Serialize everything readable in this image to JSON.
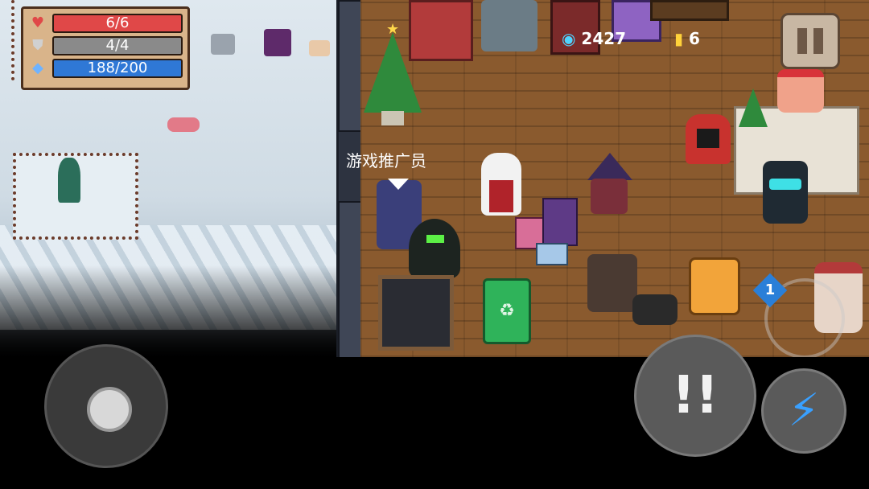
{
  "hud": {
    "hp": {
      "label": "6/6",
      "value": 6,
      "max": 6,
      "color": "#e04848"
    },
    "armor": {
      "label": "4/4",
      "value": 4,
      "max": 4,
      "color": "#8a8a8a"
    },
    "energy": {
      "label": "188/200",
      "value": 188,
      "max": 200,
      "color": "#2f78d6"
    },
    "icons": [
      "heart-icon",
      "shield-icon",
      "energy-crystal-icon"
    ]
  },
  "currency": {
    "gems": "2427",
    "coins": "6",
    "gem_icon": "gem-icon",
    "coin_icon": "coin-icon"
  },
  "npc": {
    "label": "游戏推广员"
  },
  "controls": {
    "pause_icon": "pause-icon",
    "attack_icon": "attack-icon",
    "skill_icon": "lightning-icon",
    "swap_badge": "1"
  },
  "colors": {
    "floor": "#8a5a2e",
    "wall": "#2d3340",
    "snow": "#dfe8ef",
    "skill": "#39a0ff"
  }
}
